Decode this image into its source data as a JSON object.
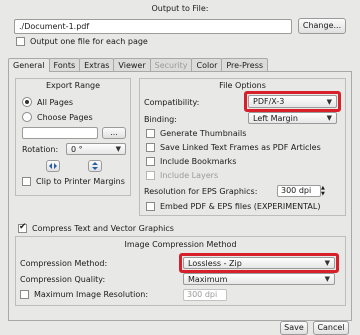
{
  "header": {
    "title": "Output to File:"
  },
  "output": {
    "file_path": "./Document-1.pdf",
    "change_label": "Change...",
    "one_file_per_page_label": "Output one file for each page",
    "one_file_per_page_checked": false
  },
  "tabs": [
    {
      "label": "General",
      "active": true,
      "disabled": false
    },
    {
      "label": "Fonts",
      "active": false,
      "disabled": false
    },
    {
      "label": "Extras",
      "active": false,
      "disabled": false
    },
    {
      "label": "Viewer",
      "active": false,
      "disabled": false
    },
    {
      "label": "Security",
      "active": false,
      "disabled": true
    },
    {
      "label": "Color",
      "active": false,
      "disabled": false
    },
    {
      "label": "Pre-Press",
      "active": false,
      "disabled": false
    }
  ],
  "export_range": {
    "title": "Export Range",
    "all_pages_label": "All Pages",
    "choose_pages_label": "Choose Pages",
    "choose_pages_value": "",
    "browse_label": "...",
    "rotation_label": "Rotation:",
    "rotation_value": "0 °",
    "clip_label": "Clip to Printer Margins"
  },
  "file_options": {
    "title": "File Options",
    "compatibility_label": "Compatibility:",
    "compatibility_value": "PDF/X-3",
    "binding_label": "Binding:",
    "binding_value": "Left Margin",
    "generate_thumbnails_label": "Generate Thumbnails",
    "save_linked_label": "Save Linked Text Frames as PDF Articles",
    "include_bookmarks_label": "Include Bookmarks",
    "include_layers_label": "Include Layers",
    "resolution_label": "Resolution for EPS Graphics:",
    "resolution_value": "300 dpi",
    "embed_label": "Embed PDF & EPS files (EXPERIMENTAL)"
  },
  "compress": {
    "label": "Compress Text and Vector Graphics",
    "checked": true
  },
  "image_compression": {
    "title": "Image Compression Method",
    "method_label": "Compression Method:",
    "method_value": "Lossless - Zip",
    "quality_label": "Compression Quality:",
    "quality_value": "Maximum",
    "max_res_label": "Maximum Image Resolution:",
    "max_res_value": "300 dpi"
  },
  "footer": {
    "save_label": "Save",
    "cancel_label": "Cancel"
  },
  "colors": {
    "highlight": "#d8202a"
  }
}
